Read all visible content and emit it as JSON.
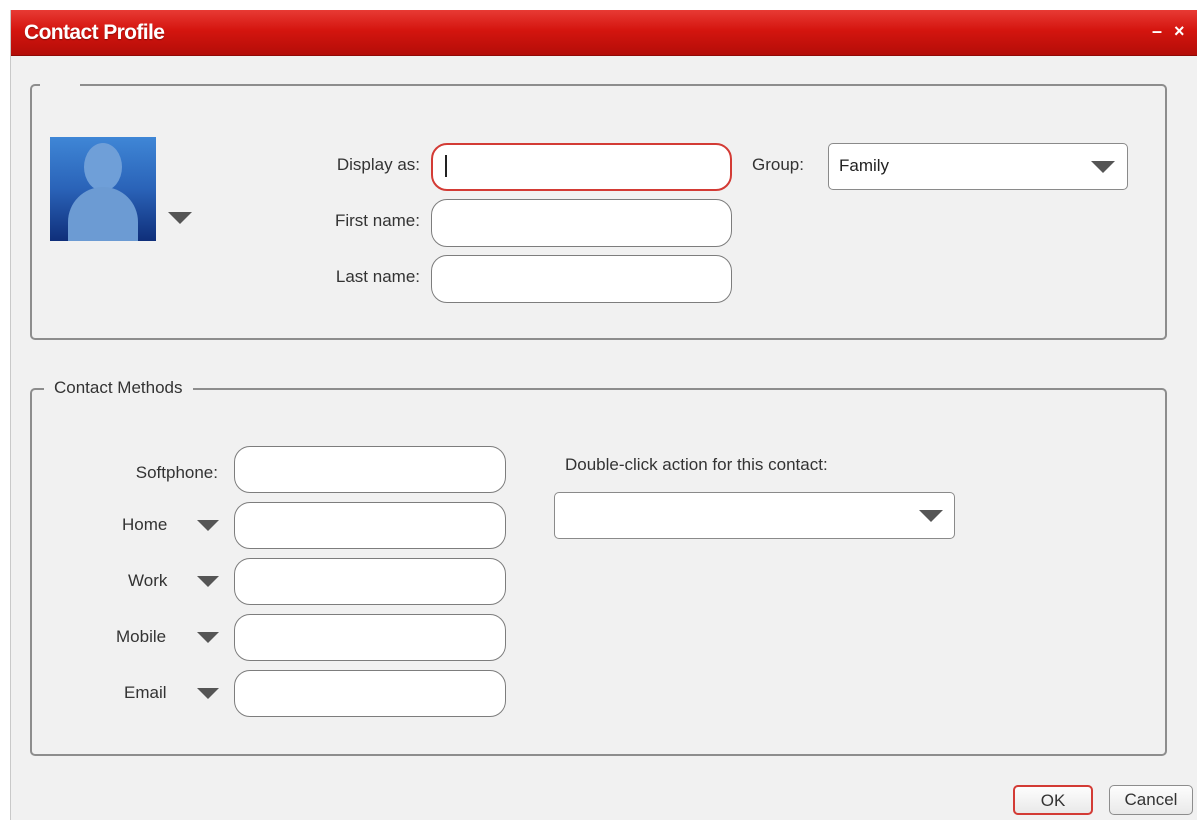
{
  "window": {
    "title": "Contact Profile",
    "minimize_label": "–",
    "close_label": "×"
  },
  "profile": {
    "display_as_label": "Display as:",
    "display_as_value": "",
    "first_name_label": "First name:",
    "first_name_value": "",
    "last_name_label": "Last name:",
    "last_name_value": "",
    "group_label": "Group:",
    "group_value": "Family"
  },
  "contact_methods": {
    "legend": "Contact Methods",
    "softphone_label": "Softphone:",
    "softphone_value": "",
    "methods": [
      {
        "label": "Home",
        "value": ""
      },
      {
        "label": "Work",
        "value": ""
      },
      {
        "label": "Mobile",
        "value": ""
      },
      {
        "label": "Email",
        "value": ""
      }
    ],
    "double_click_label": "Double-click action for this contact:",
    "double_click_value": ""
  },
  "buttons": {
    "ok": "OK",
    "cancel": "Cancel"
  },
  "colors": {
    "title_bar": "#d4150f",
    "focus_border": "#d33b35",
    "window_bg": "#f1f1f1"
  }
}
